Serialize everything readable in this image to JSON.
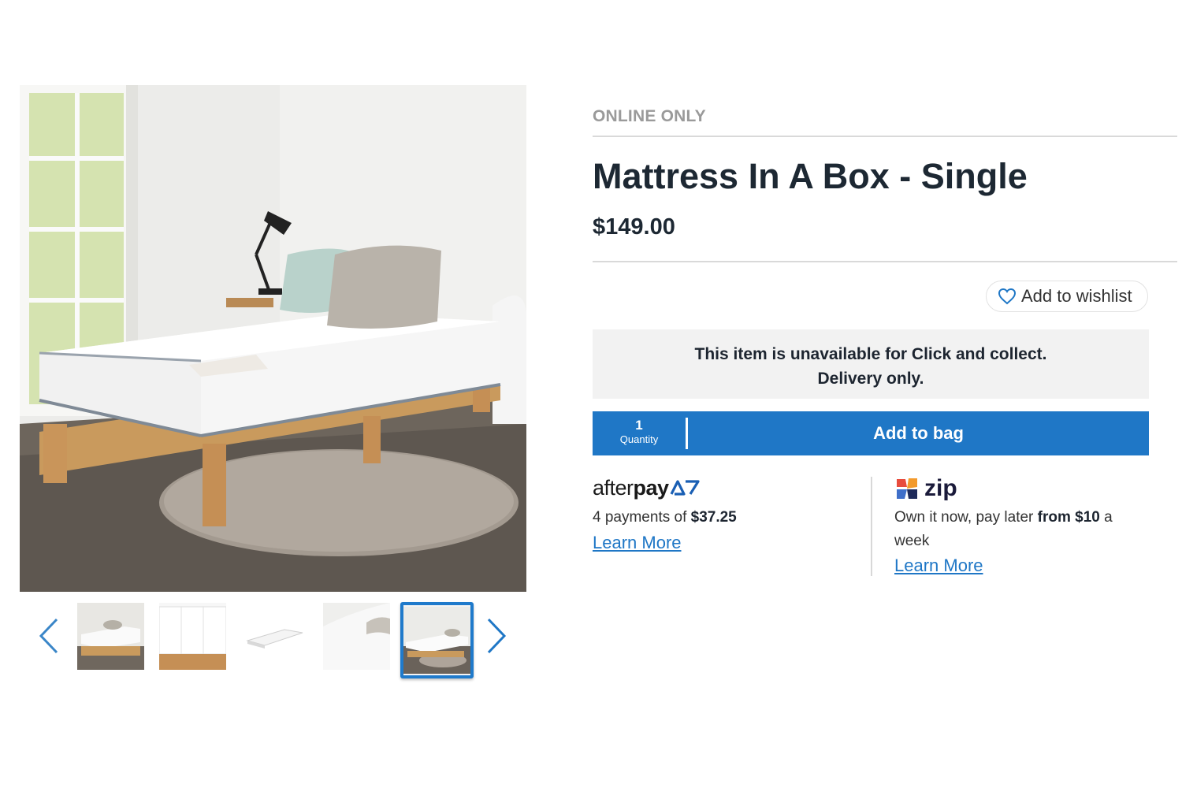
{
  "gallery": {
    "main_image_alt": "",
    "thumbnail_count": 5,
    "active_thumbnail_index": 5
  },
  "product": {
    "badge": "ONLINE ONLY",
    "title": "Mattress In A Box - Single",
    "price": "$149.00",
    "wishlist_label": "Add to wishlist",
    "notice_line1": "This item is unavailable for Click and collect.",
    "notice_line2": "Delivery only."
  },
  "cart": {
    "quantity": "1",
    "quantity_label": "Quantity",
    "add_label": "Add to bag"
  },
  "payments": {
    "afterpay": {
      "logo_text_light": "after",
      "logo_text_bold": "pay",
      "text_prefix": "4 payments of ",
      "amount": "$37.25",
      "learn_more": "Learn More"
    },
    "zip": {
      "logo_text": "zip",
      "text_prefix": "Own it now, pay later ",
      "text_bold": "from $10",
      "text_suffix": " a week",
      "learn_more": "Learn More"
    }
  },
  "colors": {
    "accent_blue": "#1f77c6",
    "text_dark": "#1d2833",
    "badge_grey": "#9a9a9a",
    "notice_bg": "#f2f2f2"
  },
  "icons": {
    "prev": "chevron-left-icon",
    "next": "chevron-right-icon",
    "wishlist": "heart-icon"
  }
}
